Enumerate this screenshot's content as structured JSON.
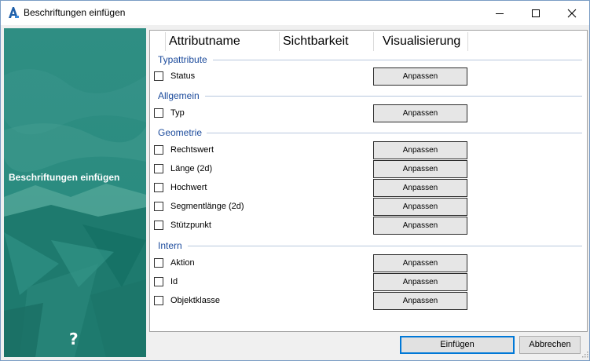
{
  "window": {
    "title": "Beschriftungen einfügen",
    "controls": [
      "minimize-icon",
      "maximize-icon",
      "close-icon"
    ]
  },
  "sidebar": {
    "title": "Beschriftungen einfügen",
    "help": "?"
  },
  "table": {
    "headers": [
      "Attributname",
      "Sichtbarkeit",
      "Visualisierung"
    ]
  },
  "groups": [
    {
      "name": "Typattribute",
      "items": [
        {
          "label": "Status",
          "checked": false,
          "button": "Anpassen"
        }
      ]
    },
    {
      "name": "Allgemein",
      "items": [
        {
          "label": "Typ",
          "checked": false,
          "button": "Anpassen"
        }
      ]
    },
    {
      "name": "Geometrie",
      "items": [
        {
          "label": "Rechtswert",
          "checked": false,
          "button": "Anpassen"
        },
        {
          "label": "Länge (2d)",
          "checked": false,
          "button": "Anpassen"
        },
        {
          "label": "Hochwert",
          "checked": false,
          "button": "Anpassen"
        },
        {
          "label": "Segmentlänge (2d)",
          "checked": false,
          "button": "Anpassen"
        },
        {
          "label": "Stützpunkt",
          "checked": false,
          "button": "Anpassen"
        }
      ]
    },
    {
      "name": "Intern",
      "items": [
        {
          "label": "Aktion",
          "checked": false,
          "button": "Anpassen"
        },
        {
          "label": "Id",
          "checked": false,
          "button": "Anpassen"
        },
        {
          "label": "Objektklasse",
          "checked": false,
          "button": "Anpassen"
        }
      ]
    }
  ],
  "footer": {
    "ok_label": "Einfügen",
    "cancel_label": "Abbrechen"
  },
  "colors": {
    "accent": "#0078d7",
    "group_heading": "#1c4b9c",
    "sidebar_teal": "#2a8c81"
  }
}
